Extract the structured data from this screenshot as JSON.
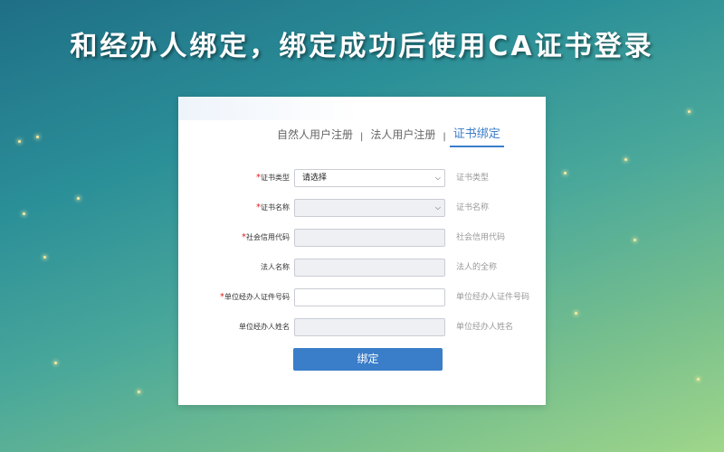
{
  "headline": "和经办人绑定，绑定成功后使用CA证书登录",
  "tabs": [
    {
      "label": "自然人用户注册",
      "active": false
    },
    {
      "label": "法人用户注册",
      "active": false
    },
    {
      "label": "证书绑定",
      "active": true
    }
  ],
  "tab_separator": "|",
  "form": {
    "rows": [
      {
        "label": "证书类型",
        "required": true,
        "value": "请选择",
        "type": "select",
        "hint": "证书类型"
      },
      {
        "label": "证书名称",
        "required": true,
        "value": "",
        "type": "select",
        "hint": "证书名称"
      },
      {
        "label": "社会信用代码",
        "required": true,
        "value": "",
        "type": "readonly",
        "hint": "社会信用代码"
      },
      {
        "label": "法人名称",
        "required": false,
        "value": "",
        "type": "readonly",
        "hint": "法人的全称"
      },
      {
        "label": "单位经办人证件号码",
        "required": true,
        "value": "",
        "type": "text",
        "hint": "单位经办人证件号码"
      },
      {
        "label": "单位经办人姓名",
        "required": false,
        "value": "",
        "type": "readonly",
        "hint": "单位经办人姓名"
      }
    ],
    "required_mark": "*",
    "submit_label": "绑定"
  },
  "colors": {
    "accent": "#3a7dc9",
    "required": "#e02020"
  }
}
